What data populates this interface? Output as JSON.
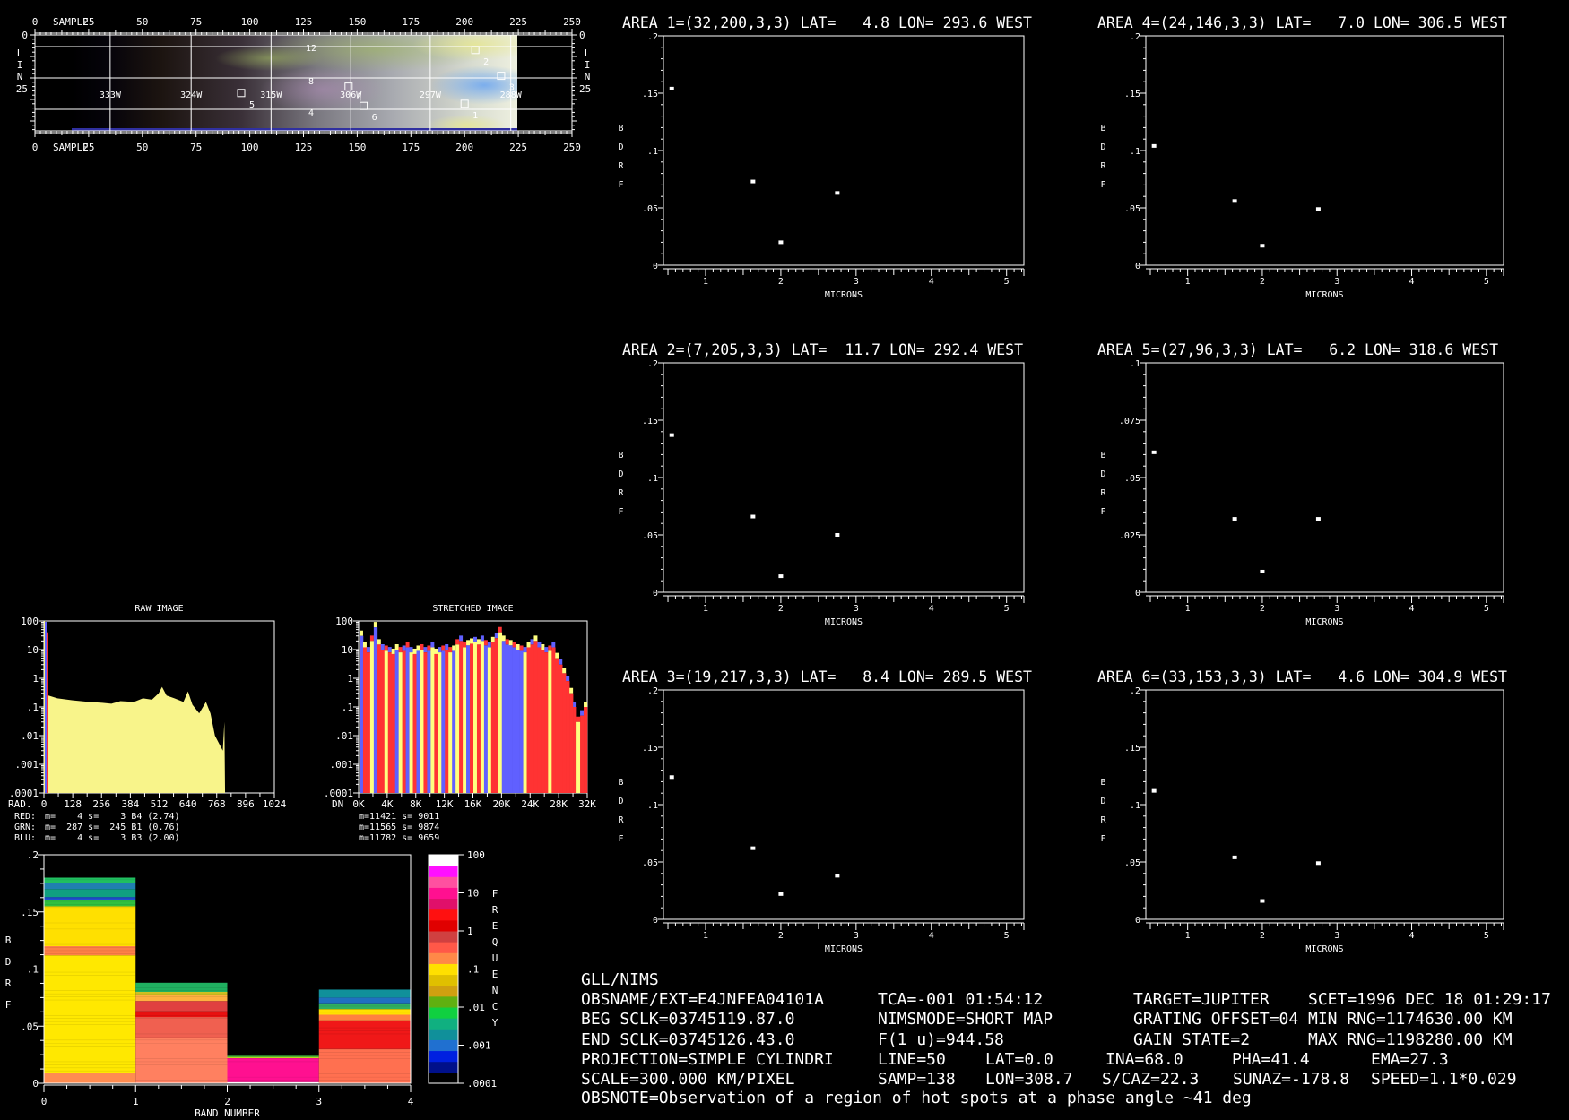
{
  "colors": {
    "background": "#000000",
    "foreground": "#ffffff",
    "red_channel": "#ff3333",
    "green_channel": "#ffff80",
    "blue_channel": "#6060ff",
    "raw_fill": "#f8f48a"
  },
  "map_image": {
    "sample_label": "SAMPLE",
    "line_letters": [
      "L",
      "I",
      "N"
    ],
    "sample_ticks": [
      "0",
      "25",
      "50",
      "75",
      "100",
      "125",
      "150",
      "175",
      "200",
      "225",
      "250"
    ],
    "sample_tick_values": [
      0,
      25,
      50,
      75,
      100,
      125,
      150,
      175,
      200,
      225,
      250
    ],
    "line_ticks": [
      "0",
      "25"
    ],
    "line_tick_values": [
      0,
      25
    ],
    "lon_labels": [
      "333W",
      "324W",
      "315W",
      "306W",
      "297W",
      "288W"
    ],
    "lon_grid_samples": [
      35,
      72.7,
      109.9,
      147,
      184,
      221.5
    ],
    "lat_labels": [
      "12",
      "8",
      "4"
    ],
    "lat_grid_lines": [
      5.4,
      20,
      34.6
    ],
    "markers": [
      {
        "label": "1",
        "line": 32,
        "sample": 200
      },
      {
        "label": "2",
        "line": 7,
        "sample": 205
      },
      {
        "label": "3",
        "line": 19,
        "sample": 217
      },
      {
        "label": "4",
        "line": 24,
        "sample": 146
      },
      {
        "label": "5",
        "line": 27,
        "sample": 96
      },
      {
        "label": "6",
        "line": 33,
        "sample": 153
      }
    ]
  },
  "chart_data": [
    {
      "id": "raw-histogram",
      "type": "area",
      "title": "RAW IMAGE",
      "xlabel": "RAD.",
      "x_ticks": [
        "0",
        "128",
        "256",
        "384",
        "512",
        "640",
        "768",
        "896",
        "1024"
      ],
      "xlim": [
        0,
        1024
      ],
      "y_ticks": [
        "100",
        "10",
        "1",
        ".1",
        ".01",
        ".001",
        ".0001"
      ],
      "ylim": [
        0.0001,
        100
      ],
      "y_scale": "log",
      "series": [
        {
          "values": [
            [
              0,
              100
            ],
            [
              4,
              100
            ],
            [
              6,
              0.5
            ],
            [
              20,
              0.25
            ],
            [
              60,
              0.2
            ],
            [
              128,
              0.17
            ],
            [
              200,
              0.15
            ],
            [
              260,
              0.14
            ],
            [
              300,
              0.13
            ],
            [
              340,
              0.16
            ],
            [
              400,
              0.15
            ],
            [
              440,
              0.2
            ],
            [
              480,
              0.18
            ],
            [
              510,
              0.3
            ],
            [
              525,
              0.5
            ],
            [
              545,
              0.25
            ],
            [
              580,
              0.2
            ],
            [
              620,
              0.15
            ],
            [
              640,
              0.35
            ],
            [
              660,
              0.12
            ],
            [
              690,
              0.06
            ],
            [
              720,
              0.15
            ],
            [
              740,
              0.06
            ],
            [
              760,
              0.01
            ],
            [
              780,
              0.005
            ],
            [
              795,
              0.003
            ],
            [
              802,
              0.03
            ],
            [
              805,
              0.0001
            ]
          ]
        }
      ],
      "stats": [
        {
          "channel": "RED:",
          "text": " m=    4 s=    3 B4 (2.74)"
        },
        {
          "channel": "GRN:",
          "text": " m=  287 s=  245 B1 (0.76)"
        },
        {
          "channel": "BLU:",
          "text": " m=    4 s=    3 B3 (2.00)"
        }
      ]
    },
    {
      "id": "stretched-histogram",
      "type": "bar",
      "title": "STRETCHED IMAGE",
      "xlabel": "DN",
      "x_ticks": [
        "0K",
        "4K",
        "8K",
        "12K",
        "16K",
        "20K",
        "24K",
        "28K",
        "32K"
      ],
      "xlim": [
        0,
        32768
      ],
      "y_ticks": [
        "100",
        "10",
        "1",
        ".1",
        ".01",
        ".001",
        ".0001"
      ],
      "ylim": [
        0.0001,
        100
      ],
      "y_scale": "log",
      "bin_tops": [
        30,
        12,
        8,
        20,
        60,
        15,
        10,
        9,
        8,
        7,
        10,
        8,
        9,
        12,
        8,
        7,
        9,
        10,
        8,
        9,
        12,
        7,
        8,
        9,
        10,
        8,
        9,
        15,
        20,
        12,
        14,
        16,
        18,
        15,
        20,
        14,
        12,
        18,
        25,
        40,
        20,
        15,
        14,
        12,
        10,
        9,
        8,
        12,
        15,
        20,
        12,
        10,
        8,
        9,
        12,
        5,
        3,
        1.5,
        0.8,
        0.3,
        0.1,
        0.03,
        0.05,
        0.1
      ],
      "bin_channels": "BRRYBRRYRRBYRBYRBYRBYRYBRYBYRYBRYRYBYRRYBBBBBBYRRRRRRYRRRRRRRYRR",
      "stats": [
        "m=11421 s= 9011",
        "m=11565 s= 9874",
        "m=11782 s= 9659"
      ]
    },
    {
      "id": "band-bdrf-histogram",
      "type": "heatmap",
      "xlabel": "BAND NUMBER",
      "ylabel": "BDRF",
      "x_ticks": [
        "0",
        "1",
        "2",
        "3",
        "4"
      ],
      "xlim": [
        0,
        4
      ],
      "y_ticks": [
        "0",
        ".05",
        ".1",
        ".15",
        ".2"
      ],
      "ylim": [
        0,
        0.2
      ],
      "bars": [
        {
          "band": [
            0,
            1
          ],
          "top": 0.18,
          "segments": [
            [
              0,
              0.009,
              "#ff8c50"
            ],
            [
              0.009,
              0.112,
              "#ffe800"
            ],
            [
              0.112,
              0.12,
              "#ff8048"
            ],
            [
              0.12,
              0.155,
              "#ffe000"
            ],
            [
              0.155,
              0.16,
              "#30c040"
            ],
            [
              0.16,
              0.163,
              "#2050d0"
            ],
            [
              0.163,
              0.17,
              "#10a080"
            ],
            [
              0.17,
              0.175,
              "#2080b0"
            ],
            [
              0.175,
              0.18,
              "#20c060"
            ]
          ]
        },
        {
          "band": [
            1,
            2
          ],
          "top": 0.088,
          "segments": [
            [
              0,
              0.04,
              "#ff8060"
            ],
            [
              0.04,
              0.058,
              "#f06050"
            ],
            [
              0.058,
              0.063,
              "#e81010"
            ],
            [
              0.063,
              0.072,
              "#e04040"
            ],
            [
              0.072,
              0.077,
              "#ffb040"
            ],
            [
              0.077,
              0.08,
              "#d0c020"
            ],
            [
              0.08,
              0.088,
              "#20b060"
            ]
          ]
        },
        {
          "band": [
            2,
            3
          ],
          "top": 0.024,
          "segments": [
            [
              0,
              0.001,
              "#ffffff"
            ],
            [
              0.001,
              0.022,
              "#ff1090"
            ],
            [
              0.022,
              0.023,
              "#c0e020"
            ],
            [
              0.023,
              0.024,
              "#40c040"
            ]
          ]
        },
        {
          "band": [
            3,
            4
          ],
          "top": 0.082,
          "segments": [
            [
              0,
              0.03,
              "#ff7050"
            ],
            [
              0.03,
              0.055,
              "#f01818"
            ],
            [
              0.055,
              0.06,
              "#ff8040"
            ],
            [
              0.06,
              0.065,
              "#ffe000"
            ],
            [
              0.065,
              0.07,
              "#30b060"
            ],
            [
              0.07,
              0.075,
              "#2070c0"
            ],
            [
              0.075,
              0.082,
              "#10909a"
            ]
          ]
        }
      ],
      "colorbar": {
        "label": "FREQUENCY",
        "ticks": [
          "100",
          "10",
          "1",
          ".1",
          ".01",
          ".001",
          ".0001"
        ],
        "range": [
          0.0001,
          100
        ],
        "colors": [
          "#000000",
          "#00108a",
          "#0020e0",
          "#2070d0",
          "#10909a",
          "#10b080",
          "#10d040",
          "#60b010",
          "#d0a010",
          "#e0c000",
          "#ffe000",
          "#ff8848",
          "#ff5848",
          "#d04040",
          "#e00000",
          "#ff1010",
          "#e0106a",
          "#ff1090",
          "#ff50a0",
          "#ff10ff",
          "#ffffff"
        ]
      }
    },
    {
      "id": "area-1",
      "type": "scatter",
      "title": "AREA 1=(32,200,3,3) LAT=   4.8 LON= 293.6 WEST",
      "xlabel": "MICRONS",
      "ylabel": "BDRF",
      "xlim": [
        0.44,
        5.23
      ],
      "ylim": [
        0,
        0.2
      ],
      "x_ticks": [
        "1",
        "2",
        "3",
        "4",
        "5"
      ],
      "y_ticks": [
        "0",
        ".05",
        ".1",
        ".15",
        ".2"
      ],
      "x": [
        0.55,
        1.63,
        2.0,
        2.75
      ],
      "y": [
        0.154,
        0.073,
        0.02,
        0.063
      ]
    },
    {
      "id": "area-2",
      "type": "scatter",
      "title": "AREA 2=(7,205,3,3) LAT=  11.7 LON= 292.4 WEST",
      "xlabel": "MICRONS",
      "ylabel": "BDRF",
      "xlim": [
        0.44,
        5.23
      ],
      "ylim": [
        0,
        0.2
      ],
      "x_ticks": [
        "1",
        "2",
        "3",
        "4",
        "5"
      ],
      "y_ticks": [
        "0",
        ".05",
        ".1",
        ".15",
        ".2"
      ],
      "x": [
        0.55,
        1.63,
        2.0,
        2.75
      ],
      "y": [
        0.137,
        0.066,
        0.014,
        0.05
      ]
    },
    {
      "id": "area-3",
      "type": "scatter",
      "title": "AREA 3=(19,217,3,3) LAT=   8.4 LON= 289.5 WEST",
      "xlabel": "MICRONS",
      "ylabel": "BDRF",
      "xlim": [
        0.44,
        5.23
      ],
      "ylim": [
        0,
        0.2
      ],
      "x_ticks": [
        "1",
        "2",
        "3",
        "4",
        "5"
      ],
      "y_ticks": [
        "0",
        ".05",
        ".1",
        ".15",
        ".2"
      ],
      "x": [
        0.55,
        1.63,
        2.0,
        2.75
      ],
      "y": [
        0.124,
        0.062,
        0.022,
        0.038
      ]
    },
    {
      "id": "area-4",
      "type": "scatter",
      "title": "AREA 4=(24,146,3,3) LAT=   7.0 LON= 306.5 WEST",
      "xlabel": "MICRONS",
      "ylabel": "BDRF",
      "xlim": [
        0.44,
        5.23
      ],
      "ylim": [
        0,
        0.2
      ],
      "x_ticks": [
        "1",
        "2",
        "3",
        "4",
        "5"
      ],
      "y_ticks": [
        "0",
        ".05",
        ".1",
        ".15",
        ".2"
      ],
      "x": [
        0.55,
        1.63,
        2.0,
        2.75
      ],
      "y": [
        0.104,
        0.056,
        0.017,
        0.049
      ]
    },
    {
      "id": "area-5",
      "type": "scatter",
      "title": "AREA 5=(27,96,3,3) LAT=   6.2 LON= 318.6 WEST",
      "xlabel": "MICRONS",
      "ylabel": "BDRF",
      "xlim": [
        0.44,
        5.23
      ],
      "ylim": [
        0,
        0.1
      ],
      "x_ticks": [
        "1",
        "2",
        "3",
        "4",
        "5"
      ],
      "y_ticks": [
        "0",
        ".025",
        ".05",
        ".075",
        ".1"
      ],
      "x": [
        0.55,
        1.63,
        2.0,
        2.75
      ],
      "y": [
        0.061,
        0.032,
        0.009,
        0.032
      ]
    },
    {
      "id": "area-6",
      "type": "scatter",
      "title": "AREA 6=(33,153,3,3) LAT=   4.6 LON= 304.9 WEST",
      "xlabel": "MICRONS",
      "ylabel": "BDRF",
      "xlim": [
        0.44,
        5.23
      ],
      "ylim": [
        0,
        0.2
      ],
      "x_ticks": [
        "1",
        "2",
        "3",
        "4",
        "5"
      ],
      "y_ticks": [
        "0",
        ".05",
        ".1",
        ".15",
        ".2"
      ],
      "x": [
        0.55,
        1.63,
        2.0,
        2.75
      ],
      "y": [
        0.112,
        0.054,
        0.016,
        0.049
      ]
    }
  ],
  "info": {
    "rows": [
      [
        "GLL/NIMS"
      ],
      [
        "OBSNAME/EXT=E4JNFEA04101A",
        "TCA=-001 01:54:12",
        "TARGET=JUPITER",
        "SCET=1996 DEC 18 01:29:17"
      ],
      [
        "BEG SCLK=03745119.87.0",
        "NIMSMODE=SHORT MAP",
        "GRATING OFFSET=04",
        "MIN RNG=1174630.00 KM"
      ],
      [
        "END SCLK=03745126.43.0",
        "F(1 u)=944.58",
        "GAIN STATE=2",
        "MAX RNG=1198280.00 KM"
      ],
      [
        "PROJECTION=SIMPLE CYLINDRI",
        "LINE=50",
        "LAT=0.0",
        "INA=68.0",
        "PHA=41.4",
        "EMA=27.3"
      ],
      [
        "SCALE=300.000 KM/PIXEL",
        "SAMP=138",
        "LON=308.7",
        "S/CAZ=22.3",
        "SUNAZ=-178.8",
        "SPEED=1.1*0.029"
      ],
      [
        "OBSNOTE=Observation of a region of hot spots at a phase angle ~41 deg"
      ]
    ]
  }
}
